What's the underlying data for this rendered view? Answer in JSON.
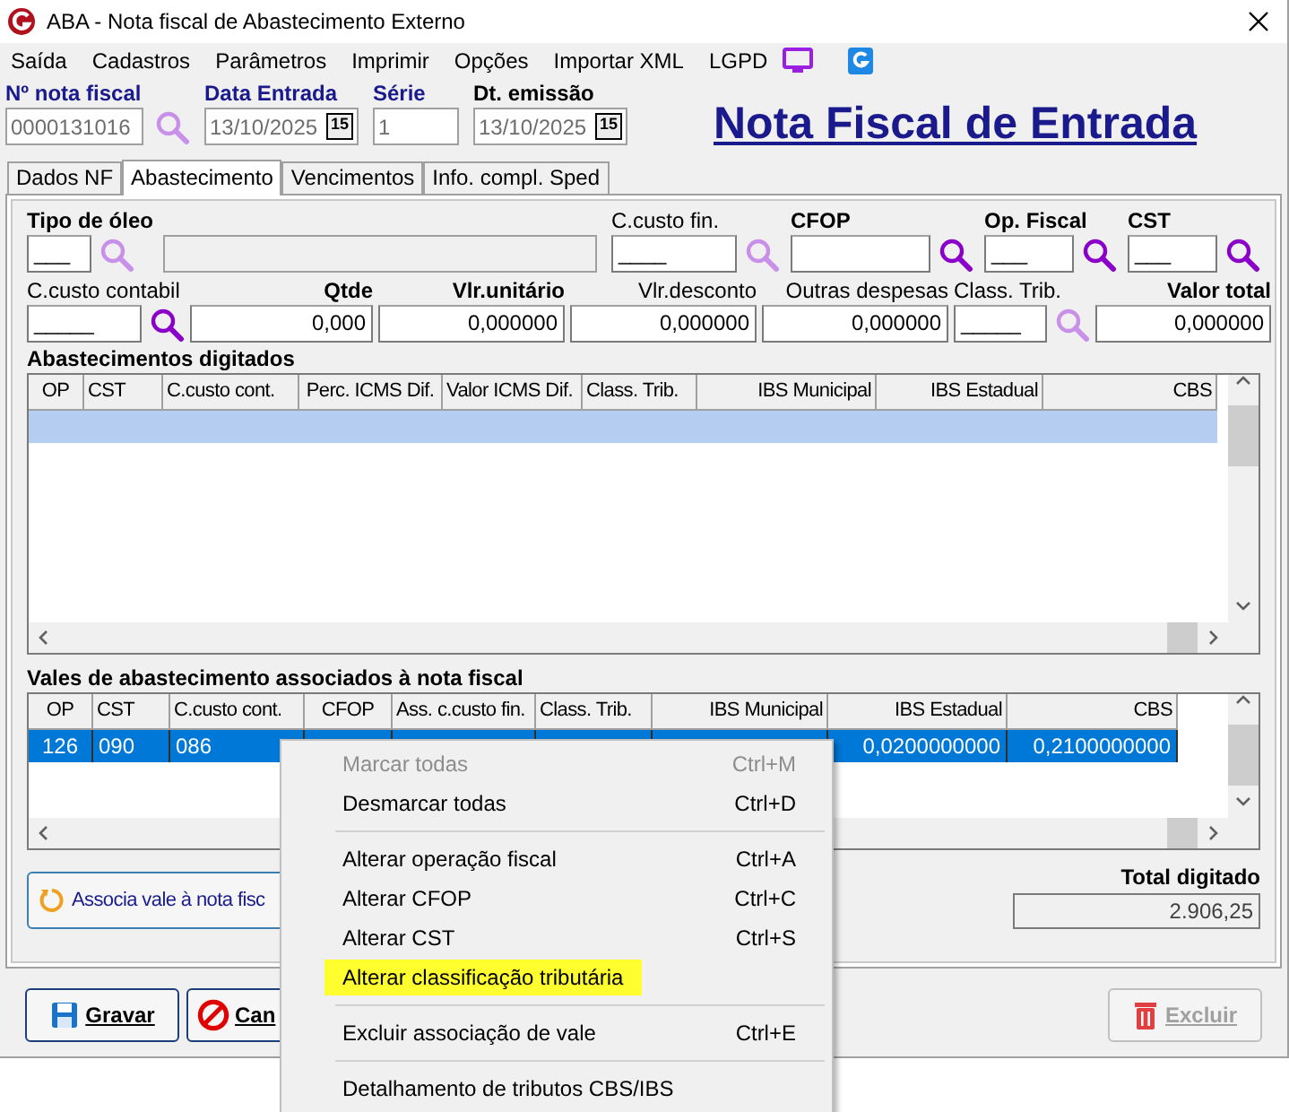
{
  "window": {
    "title": "ABA - Nota fiscal de Abastecimento Externo"
  },
  "menu": [
    "Saída",
    "Cadastros",
    "Parâmetros",
    "Imprimir",
    "Opções",
    "Importar XML",
    "LGPD"
  ],
  "header": {
    "fields": [
      {
        "label": "Nº nota fiscal",
        "value": "0000131016",
        "kind": "search"
      },
      {
        "label": "Data Entrada",
        "value": "13/10/2025",
        "kind": "date",
        "calendar_day": "15"
      },
      {
        "label": "Série",
        "value": "1",
        "kind": "plain"
      },
      {
        "label": "Dt. emissão",
        "value": "13/10/2025",
        "kind": "date",
        "calendar_day": "15"
      }
    ],
    "heading": "Nota Fiscal de Entrada"
  },
  "tabs": [
    {
      "label": "Dados NF",
      "selected": false
    },
    {
      "label": "Abastecimento",
      "selected": true
    },
    {
      "label": "Vencimentos",
      "selected": false
    },
    {
      "label": "Info. compl. Sped",
      "selected": false
    }
  ],
  "row_1": [
    {
      "label": "Tipo de óleo",
      "bold": true,
      "value": "___",
      "search": true,
      "search_disabled": true,
      "description_field": true
    },
    {
      "label": "C.custo fin.",
      "bold": false,
      "value": "____",
      "search": true,
      "search_disabled": true
    },
    {
      "label": "CFOP",
      "bold": true,
      "search": true,
      "search_disabled": false
    },
    {
      "label": "Op. Fiscal",
      "bold": true,
      "value": "___",
      "search": true,
      "search_disabled": false
    },
    {
      "label": "CST",
      "bold": true,
      "value": "___",
      "search": true,
      "search_disabled": false
    }
  ],
  "row_2": [
    {
      "label": "C.custo contabil",
      "bold": false,
      "value": "_____",
      "search": true,
      "search_disabled": false
    },
    {
      "label": "Qtde",
      "bold": true,
      "value": "0,000"
    },
    {
      "label": "Vlr.unitário",
      "bold": true,
      "value": "0,000000"
    },
    {
      "label": "Vlr.desconto",
      "bold": false,
      "value": "0,000000"
    },
    {
      "label": "Outras despesas",
      "bold": false,
      "value": "0,000000"
    },
    {
      "label": "Class. Trib.",
      "bold": false,
      "value": "_____",
      "search": true,
      "search_disabled": true
    },
    {
      "label": "Valor total",
      "bold": true,
      "value": "0,000000"
    }
  ],
  "grid_1": {
    "title": "Abastecimentos digitados",
    "columns": [
      "OP",
      "CST",
      "C.custo cont.",
      "Perc. ICMS Dif.",
      "Valor ICMS Dif.",
      "Class. Trib.",
      "IBS Municipal",
      "IBS Estadual",
      "CBS"
    ],
    "rows": [
      {
        "selected": true
      }
    ]
  },
  "grid_2": {
    "title": "Vales de abastecimento associados à nota fiscal",
    "columns": [
      "OP",
      "CST",
      "C.custo cont.",
      "CFOP",
      "Ass. c.custo fin.",
      "Class. Trib.",
      "IBS Municipal",
      "IBS Estadual",
      "CBS"
    ],
    "rows": [
      {
        "selected": true,
        "cells": [
          "126",
          "090",
          "086",
          null,
          null,
          null,
          null,
          "0,0200000000",
          "0,2100000000"
        ]
      }
    ]
  },
  "associate_button": "Associa vale à nota fisc",
  "total": {
    "label": "Total digitado",
    "value": "2.906,25"
  },
  "buttons": [
    {
      "label": "Gravar",
      "kind": "save",
      "disabled": false
    },
    {
      "label": "Can",
      "kind": "cancel",
      "disabled": false
    },
    {
      "label": "Excluir",
      "kind": "delete",
      "disabled": true
    }
  ],
  "context_menu": [
    {
      "kind": "item",
      "label": "Marcar todas",
      "shortcut": "Ctrl+M",
      "disabled": true,
      "highlighted": false
    },
    {
      "kind": "item",
      "label": "Desmarcar todas",
      "shortcut": "Ctrl+D",
      "disabled": false,
      "highlighted": false
    },
    {
      "kind": "separator"
    },
    {
      "kind": "item",
      "label": "Alterar operação fiscal",
      "shortcut": "Ctrl+A",
      "disabled": false,
      "highlighted": false
    },
    {
      "kind": "item",
      "label": "Alterar CFOP",
      "shortcut": "Ctrl+C",
      "disabled": false,
      "highlighted": false
    },
    {
      "kind": "item",
      "label": "Alterar CST",
      "shortcut": "Ctrl+S",
      "disabled": false,
      "highlighted": false
    },
    {
      "kind": "item",
      "label": "Alterar classificação tributária",
      "disabled": false,
      "highlighted": true
    },
    {
      "kind": "separator"
    },
    {
      "kind": "item",
      "label": "Excluir associação de vale",
      "shortcut": "Ctrl+E",
      "disabled": false,
      "highlighted": false
    },
    {
      "kind": "separator"
    },
    {
      "kind": "item",
      "label": "Detalhamento de tributos CBS/IBS",
      "disabled": false,
      "highlighted": false
    }
  ]
}
